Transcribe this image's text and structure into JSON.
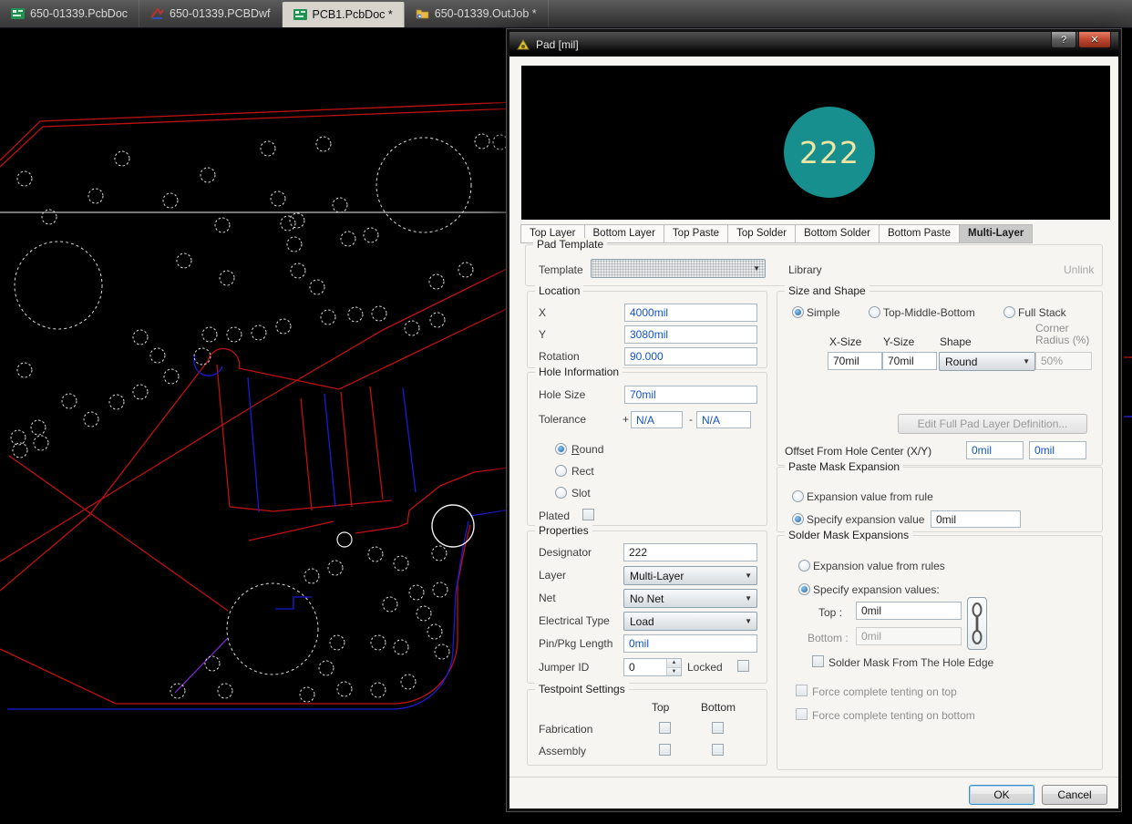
{
  "tab_bar": {
    "tabs": [
      {
        "label": "650-01339.PcbDoc",
        "icon": "pcb-document-icon",
        "active": false
      },
      {
        "label": "650-01339.PCBDwf",
        "icon": "pcb-dwf-icon",
        "active": false
      },
      {
        "label": "PCB1.PcbDoc *",
        "icon": "pcb-document-icon",
        "active": true
      },
      {
        "label": "650-01339.OutJob *",
        "icon": "outjob-icon",
        "active": false
      }
    ]
  },
  "dialog": {
    "title": "Pad [mil]",
    "titlebar": {
      "help_label": "?",
      "close_label": "✕"
    },
    "preview": {
      "designator": "222"
    },
    "layer_tabs": {
      "tabs": [
        "Top Layer",
        "Bottom Layer",
        "Top Paste",
        "Top Solder",
        "Bottom Solder",
        "Bottom Paste",
        "Multi-Layer"
      ],
      "active": "Multi-Layer"
    },
    "pad_template": {
      "group_label": "Pad Template",
      "template_label": "Template",
      "template_value": "",
      "library_label": "Library",
      "unlink_label": "Unlink"
    },
    "location": {
      "group_label": "Location",
      "x_label": "X",
      "x_value": "4000mil",
      "y_label": "Y",
      "y_value": "3080mil",
      "rotation_label": "Rotation",
      "rotation_value": "90.000"
    },
    "hole_information": {
      "group_label": "Hole Information",
      "hole_size_label": "Hole Size",
      "hole_size_value": "70mil",
      "tolerance_label": "Tolerance",
      "tolerance_plus_sign": "+",
      "tolerance_plus_value": "N/A",
      "tolerance_minus_sign": "-",
      "tolerance_minus_value": "N/A",
      "shape_options": {
        "round": "Round",
        "rect": "Rect",
        "slot": "Slot"
      },
      "selected_shape": "Round",
      "plated_label": "Plated",
      "plated_checked": false
    },
    "properties": {
      "group_label": "Properties",
      "designator_label": "Designator",
      "designator_value": "222",
      "layer_label": "Layer",
      "layer_value": "Multi-Layer",
      "net_label": "Net",
      "net_value": "No Net",
      "electrical_type_label": "Electrical Type",
      "electrical_type_value": "Load",
      "pin_pkg_label": "Pin/Pkg Length",
      "pin_pkg_value": "0mil",
      "jumper_id_label": "Jumper ID",
      "jumper_id_value": "0",
      "locked_label": "Locked",
      "locked_checked": false
    },
    "testpoint": {
      "group_label": "Testpoint Settings",
      "col_top": "Top",
      "col_bottom": "Bottom",
      "row_fabrication": "Fabrication",
      "row_assembly": "Assembly",
      "fabrication_top": false,
      "fabrication_bottom": false,
      "assembly_top": false,
      "assembly_bottom": false
    },
    "size_shape": {
      "group_label": "Size and Shape",
      "mode_simple": "Simple",
      "mode_tmb": "Top-Middle-Bottom",
      "mode_full": "Full Stack",
      "selected_mode": "Simple",
      "xsize_header": "X-Size",
      "ysize_header": "Y-Size",
      "shape_header": "Shape",
      "corner_header": "Corner Radius (%)",
      "xsize_value": "70mil",
      "ysize_value": "70mil",
      "shape_value": "Round",
      "corner_value": "50%",
      "edit_button_label": "Edit Full Pad Layer Definition...",
      "offset_label": "Offset From Hole Center (X/Y)",
      "offset_x_value": "0mil",
      "offset_y_value": "0mil"
    },
    "paste_mask": {
      "group_label": "Paste Mask Expansion",
      "from_rule_label": "Expansion value from rule",
      "specify_label": "Specify expansion value",
      "specify_selected": true,
      "value": "0mil"
    },
    "solder_mask": {
      "group_label": "Solder Mask Expansions",
      "from_rules_label": "Expansion value from rules",
      "specify_label": "Specify expansion values:",
      "specify_selected": true,
      "top_label": "Top :",
      "top_value": "0mil",
      "bottom_label": "Bottom :",
      "bottom_value": "0mil",
      "hole_edge_label": "Solder Mask From The Hole Edge",
      "tent_top_label": "Force complete tenting on top",
      "tent_bottom_label": "Force complete tenting on bottom"
    },
    "footer": {
      "ok_label": "OK",
      "cancel_label": "Cancel"
    }
  },
  "colors": {
    "pad_fill": "#178F8F",
    "pad_text": "#EDE5A1",
    "value_text": "#1153C9",
    "close_button": "#B8392A",
    "board_outline": "#C01010",
    "trace_blue": "#1B1BD6"
  }
}
